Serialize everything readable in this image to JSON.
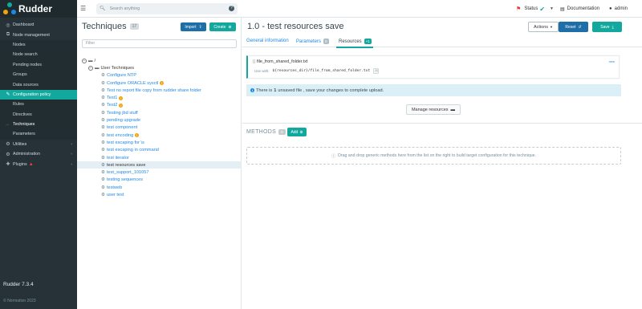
{
  "app": {
    "name": "Rudder",
    "version": "Rudder 7.3.4",
    "copyright": "© Normation 2023"
  },
  "sidebar": {
    "items": [
      {
        "label": "Dashboard",
        "icon": "dashboard-icon",
        "level": 0
      },
      {
        "label": "Node management",
        "icon": "sitemap-icon",
        "level": 0
      },
      {
        "label": "Nodes",
        "level": 1
      },
      {
        "label": "Node search",
        "level": 1
      },
      {
        "label": "Pending nodes",
        "level": 1
      },
      {
        "label": "Groups",
        "level": 1
      },
      {
        "label": "Data sources",
        "level": 1
      },
      {
        "label": "Configuration policy",
        "icon": "pencil-icon",
        "level": 0,
        "active": true
      },
      {
        "label": "Rules",
        "level": 1
      },
      {
        "label": "Directives",
        "level": 1
      },
      {
        "label": "Techniques",
        "level": 1,
        "current": true
      },
      {
        "label": "Parameters",
        "level": 1
      },
      {
        "label": "Utilities",
        "icon": "gear-icon",
        "level": 0,
        "caret": true
      },
      {
        "label": "Administration",
        "icon": "cog-icon",
        "level": 0,
        "caret": true
      },
      {
        "label": "Plugins",
        "icon": "puzzle-icon",
        "level": 0,
        "caret": true,
        "warn": true
      }
    ]
  },
  "topbar": {
    "search_placeholder": "Search anything",
    "status_label": "Status",
    "documentation_label": "Documentation",
    "user_label": "admin"
  },
  "techniques": {
    "title": "Techniques",
    "count": "17",
    "import_label": "Import",
    "create_label": "Create",
    "filter_placeholder": "Filter",
    "root_label": "/",
    "folder_label": "User Techniques",
    "items": [
      {
        "label": "Configure NTP",
        "link": true
      },
      {
        "label": "Configure ORACLE sysctl",
        "link": true,
        "warn": true
      },
      {
        "label": "Test no report file copy from rudder share folder",
        "link": true
      },
      {
        "label": "Test1",
        "link": true,
        "warn": true
      },
      {
        "label": "Test2",
        "link": true,
        "warn": true
      },
      {
        "label": "Testing jbd stuff",
        "link": true
      },
      {
        "label": "pending upgrade",
        "link": true
      },
      {
        "label": "test component",
        "link": true
      },
      {
        "label": "test encoding",
        "link": true,
        "warn": true
      },
      {
        "label": "test escaping for \\s",
        "link": true
      },
      {
        "label": "test escaping in command",
        "link": true
      },
      {
        "label": "test iterator",
        "link": true
      },
      {
        "label": "test resources save",
        "link": false,
        "selected": true
      },
      {
        "label": "test_support_101057",
        "link": true
      },
      {
        "label": "testing sequences",
        "link": true
      },
      {
        "label": "testweb",
        "link": true
      },
      {
        "label": "user test",
        "link": true
      }
    ]
  },
  "detail": {
    "title": "1.0 - test resources save",
    "actions_label": "Actions",
    "reset_label": "Reset",
    "save_label": "Save",
    "tabs": [
      {
        "label": "General information",
        "badge": ""
      },
      {
        "label": "Parameters",
        "badge": "0"
      },
      {
        "label": "Resources",
        "badge": "+1"
      }
    ],
    "resource": {
      "filename": "file_from_shared_folder.txt",
      "status": "new",
      "use_with_label": "Use with:",
      "path": "${resources_dir}/file_from_shared_folder.txt"
    },
    "info_pre": "There is ",
    "info_count": "1",
    "info_post": " unsaved file , save your changes to complete upload.",
    "manage_label": "Manage resources",
    "methods_label": "METHODS",
    "methods_count": "0",
    "add_label": "Add",
    "drop_text": "Drag and drop generic methods here from the list on the right to build target configuration for this technique."
  },
  "colors": {
    "sidebar_bg": "#263238",
    "accent": "#13a89e",
    "primary": "#1e6ea8",
    "link": "#1e88e5",
    "warning": "#f0a30a",
    "info_bg": "#daf0f6"
  }
}
